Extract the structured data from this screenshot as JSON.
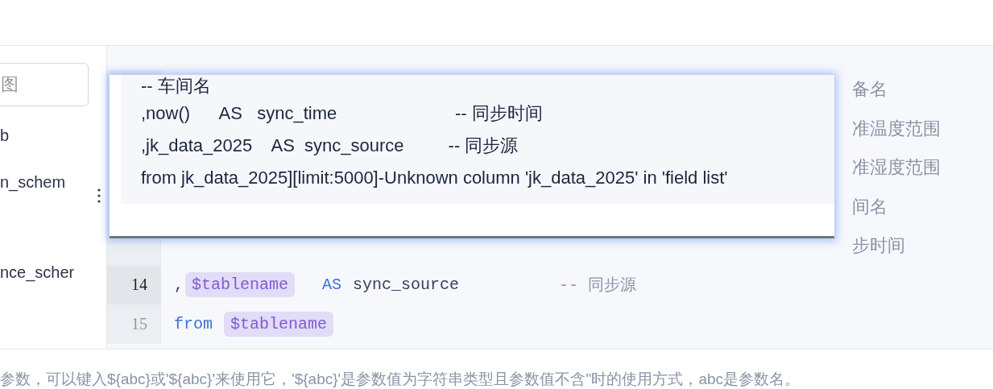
{
  "sidebar": {
    "search": {
      "placeholder": "图"
    },
    "items": [
      {
        "label": "b"
      },
      {
        "label": "n_schem"
      },
      {
        "label": "nce_scher"
      }
    ]
  },
  "editor": {
    "rows": [
      {
        "note": "备名"
      },
      {
        "note": "准温度范围"
      },
      {
        "note": "准湿度范围"
      },
      {
        "note": "间名"
      },
      {
        "note": "步时间"
      },
      {
        "line": "14",
        "current": true,
        "tokens": [
          {
            "kind": "plain",
            "text": ","
          },
          {
            "kind": "param",
            "text": "$tablename"
          },
          {
            "kind": "keyword",
            "text": "AS"
          },
          {
            "kind": "plain",
            "text": "sync_source"
          },
          {
            "kind": "comment",
            "text": "-- 同步源"
          }
        ],
        "note": ""
      },
      {
        "line": "15",
        "current": false,
        "tokens": [
          {
            "kind": "keyword",
            "text": "from"
          },
          {
            "kind": "param",
            "text": "$tablename"
          }
        ],
        "note": ""
      }
    ]
  },
  "tooltip": {
    "lines": [
      "-- 车间名",
      ",now()      AS   sync_time                        -- 同步时间",
      ",jk_data_2025    AS  sync_source         -- 同步源",
      "from jk_data_2025][limit:5000]-Unknown column 'jk_data_2025' in 'field list'"
    ]
  },
  "hint": "参数，可以键入${abc}或'${abc}'来使用它，'${abc}'是参数值为字符串类型且参数值不含''时的使用方式，abc是参数名。"
}
